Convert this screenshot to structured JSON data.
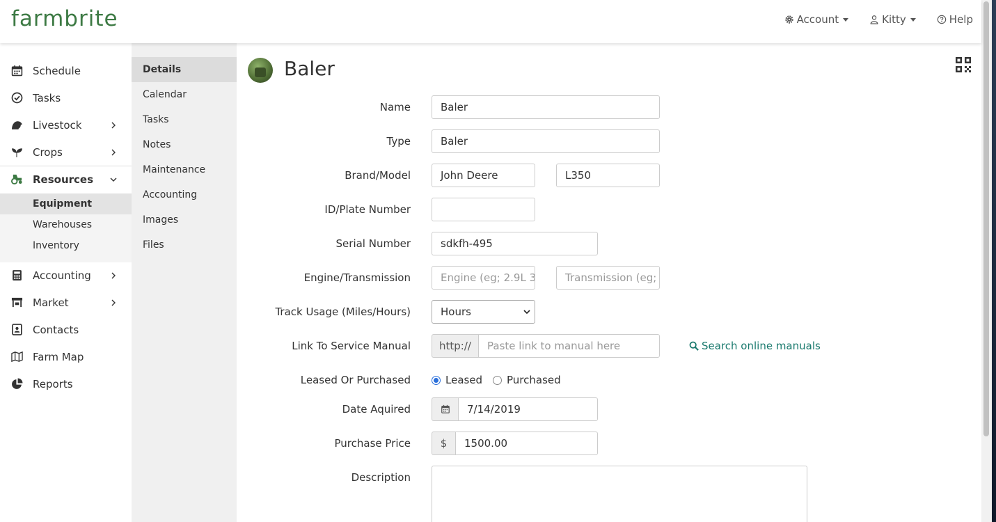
{
  "brand": {
    "logo_text": "farmbrite",
    "color": "#3d7a44"
  },
  "topnav": {
    "account": "Account",
    "user": "Kitty",
    "help": "Help"
  },
  "sidebar": {
    "items": [
      {
        "label": "Schedule",
        "icon": "calendar-icon"
      },
      {
        "label": "Tasks",
        "icon": "check-circle-icon"
      },
      {
        "label": "Livestock",
        "icon": "livestock-icon",
        "expandable": true
      },
      {
        "label": "Crops",
        "icon": "seedling-icon",
        "expandable": true
      },
      {
        "label": "Resources",
        "icon": "tractor-icon",
        "expanded": true,
        "active": true
      },
      {
        "label": "Accounting",
        "icon": "calculator-icon",
        "expandable": true
      },
      {
        "label": "Market",
        "icon": "store-icon",
        "expandable": true
      },
      {
        "label": "Contacts",
        "icon": "contact-book-icon"
      },
      {
        "label": "Farm Map",
        "icon": "map-icon"
      },
      {
        "label": "Reports",
        "icon": "pie-chart-icon"
      }
    ],
    "resources_sub": [
      "Equipment",
      "Warehouses",
      "Inventory"
    ]
  },
  "subtabs": [
    "Details",
    "Calendar",
    "Tasks",
    "Notes",
    "Maintenance",
    "Accounting",
    "Images",
    "Files"
  ],
  "page": {
    "title": "Baler"
  },
  "form": {
    "name": {
      "label": "Name",
      "value": "Baler"
    },
    "type": {
      "label": "Type",
      "value": "Baler"
    },
    "brand_model": {
      "label": "Brand/Model",
      "brand": "John Deere",
      "model": "L350"
    },
    "plate": {
      "label": "ID/Plate Number",
      "value": ""
    },
    "serial": {
      "label": "Serial Number",
      "value": "sdkfh-495"
    },
    "engine": {
      "label": "Engine/Transmission",
      "engine_placeholder": "Engine (eg; 2.9L 3",
      "transmission_placeholder": "Transmission (eg;"
    },
    "usage": {
      "label": "Track Usage (Miles/Hours)",
      "value": "Hours"
    },
    "manual": {
      "label": "Link To Service Manual",
      "prefix": "http://",
      "placeholder": "Paste link to manual here",
      "search_link": "Search online manuals"
    },
    "leased": {
      "label": "Leased Or Purchased",
      "option_leased": "Leased",
      "option_purchased": "Purchased",
      "selected": "Leased"
    },
    "date": {
      "label": "Date Aquired",
      "value": "7/14/2019"
    },
    "price": {
      "label": "Purchase Price",
      "prefix": "$",
      "value": "1500.00"
    },
    "description": {
      "label": "Description",
      "value": ""
    }
  }
}
